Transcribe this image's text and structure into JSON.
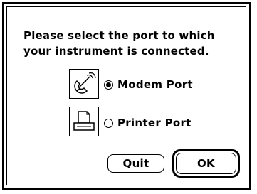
{
  "dialog": {
    "message": "Please select the port to which\nyour instrument is connected.",
    "options": [
      {
        "label": "Modem Port",
        "selected": true,
        "icon": "telephone-icon"
      },
      {
        "label": "Printer Port",
        "selected": false,
        "icon": "printer-icon"
      }
    ],
    "buttons": {
      "quit_label": "Quit",
      "ok_label": "OK"
    },
    "default_button": "OK"
  }
}
